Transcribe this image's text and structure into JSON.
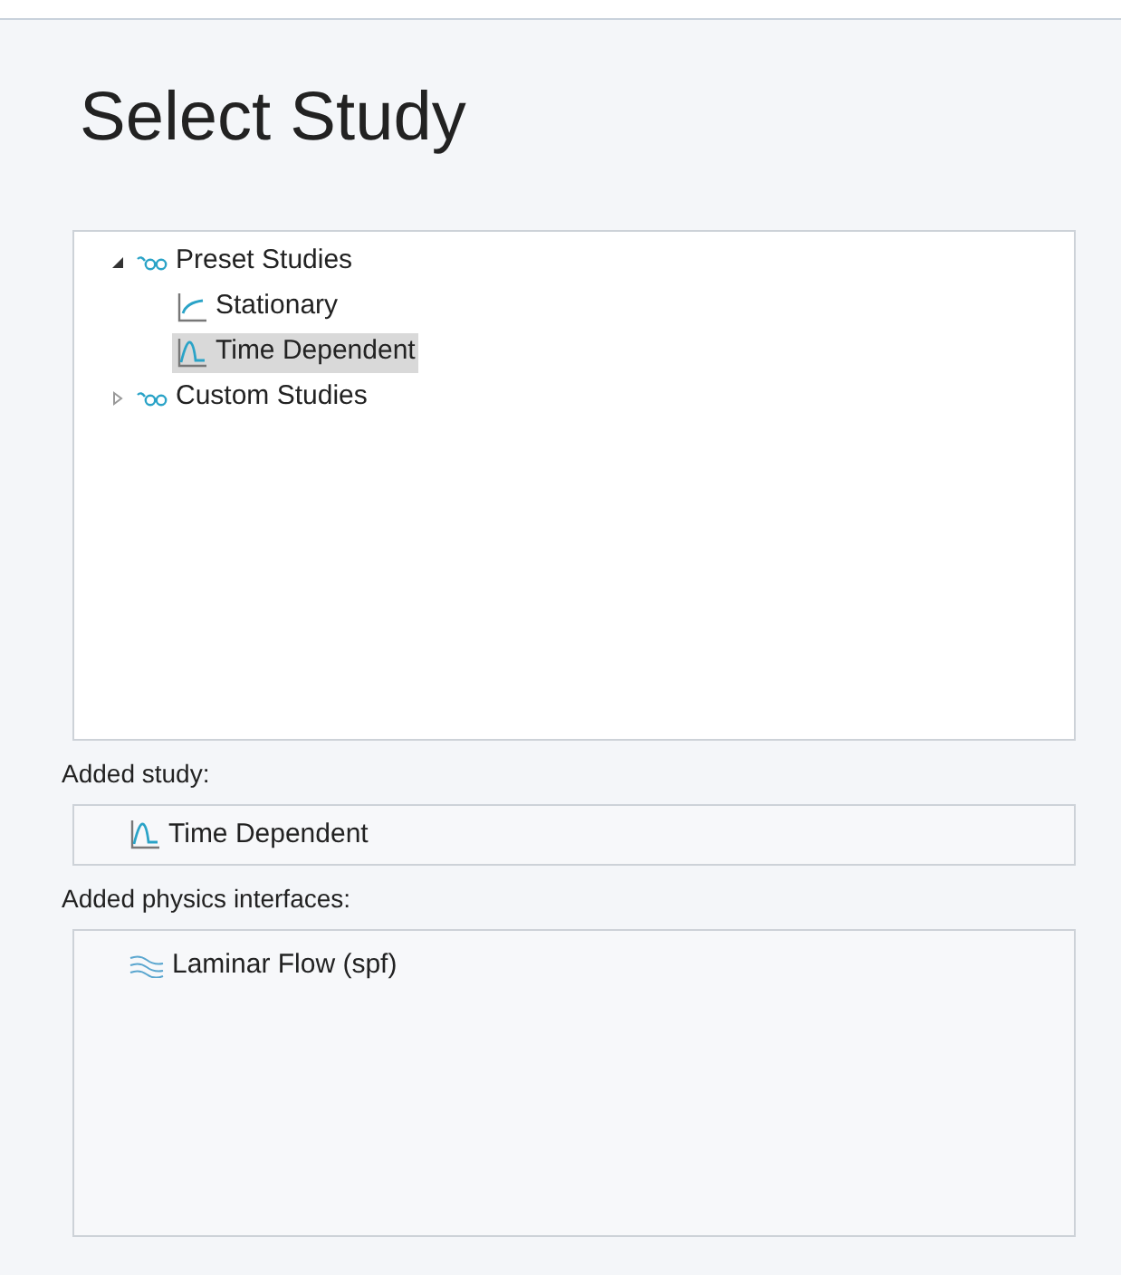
{
  "title": "Select Study",
  "tree": [
    {
      "label": "Preset Studies",
      "kind": "group",
      "expanded": true,
      "selected": false,
      "children": [
        {
          "label": "Stationary",
          "kind": "stationary",
          "selected": false
        },
        {
          "label": "Time Dependent",
          "kind": "time",
          "selected": true
        }
      ]
    },
    {
      "label": "Custom Studies",
      "kind": "group",
      "expanded": false,
      "selected": false
    }
  ],
  "added_study": {
    "label": "Added study:",
    "items": [
      {
        "label": "Time Dependent",
        "kind": "time"
      }
    ]
  },
  "added_physics": {
    "label": "Added physics interfaces:",
    "items": [
      {
        "label": "Laminar Flow (spf)",
        "kind": "flow"
      }
    ]
  }
}
